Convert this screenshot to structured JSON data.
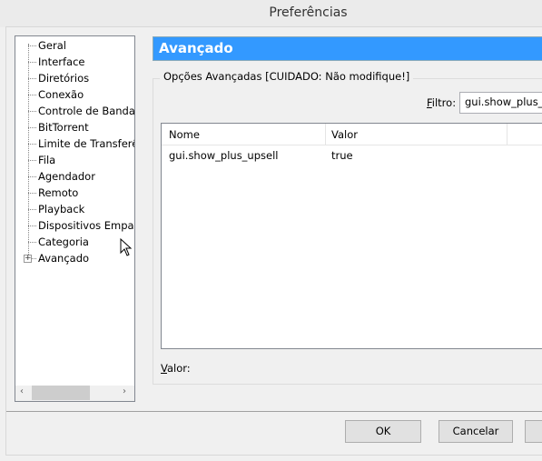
{
  "window": {
    "title": "Preferências"
  },
  "sidebar": {
    "items": [
      {
        "label": "Geral"
      },
      {
        "label": "Interface"
      },
      {
        "label": "Diretórios"
      },
      {
        "label": "Conexão"
      },
      {
        "label": "Controle de Banda"
      },
      {
        "label": "BitTorrent"
      },
      {
        "label": "Limite de Transferência"
      },
      {
        "label": "Fila"
      },
      {
        "label": "Agendador"
      },
      {
        "label": "Remoto"
      },
      {
        "label": "Playback"
      },
      {
        "label": "Dispositivos Emparelhados"
      },
      {
        "label": "Categoria"
      },
      {
        "label": "Avançado",
        "expandable": true,
        "selected": true
      }
    ]
  },
  "panel": {
    "header": "Avançado",
    "header_color": "#3399ff",
    "group_label": "Opções Avançadas [CUIDADO: Não modifique!]",
    "filter_label": "Filtro:",
    "filter_value": "gui.show_plus_upsell",
    "columns": [
      "Nome",
      "Valor"
    ],
    "rows": [
      {
        "name": "gui.show_plus_upsell",
        "value": "true"
      }
    ],
    "value_label": "Valor:"
  },
  "footer": {
    "ok": "OK",
    "cancel": "Cancelar",
    "apply": ""
  }
}
